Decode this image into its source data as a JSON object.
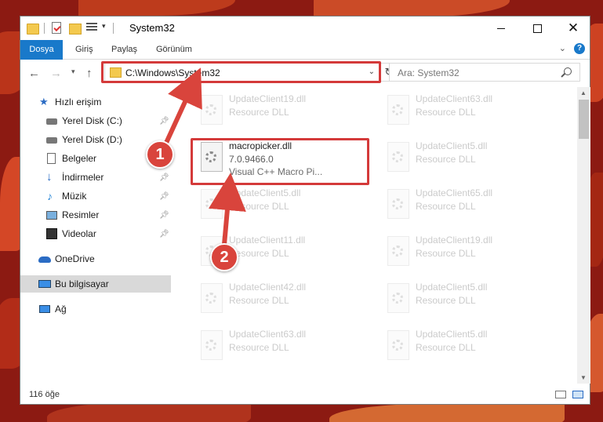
{
  "window": {
    "title": "System32",
    "controls": {
      "minimize": "",
      "maximize": "",
      "close": "✕"
    }
  },
  "ribbon": {
    "tabs": [
      "Dosya",
      "Giriş",
      "Paylaş",
      "Görünüm"
    ],
    "help": "?"
  },
  "address": {
    "path": "C:\\Windows\\System32",
    "search_placeholder": "Ara: System32"
  },
  "sidebar": {
    "quick_access": "Hızlı erişim",
    "items": [
      {
        "label": "Yerel Disk (C:)",
        "icon": "disk-icon",
        "pinned": true
      },
      {
        "label": "Yerel Disk (D:)",
        "icon": "disk-icon",
        "pinned": false
      },
      {
        "label": "Belgeler",
        "icon": "documents-icon",
        "pinned": true
      },
      {
        "label": "İndirmeler",
        "icon": "download-icon",
        "pinned": true
      },
      {
        "label": "Müzik",
        "icon": "music-icon",
        "pinned": true
      },
      {
        "label": "Resimler",
        "icon": "pictures-icon",
        "pinned": true
      },
      {
        "label": "Videolar",
        "icon": "videos-icon",
        "pinned": true
      }
    ],
    "onedrive": "OneDrive",
    "this_pc": "Bu bilgisayar",
    "network": "Ağ"
  },
  "files": {
    "focus": {
      "name": "macropicker.dll",
      "version": "7.0.9466.0",
      "description": "Visual C++ Macro Pi..."
    },
    "left_column": [
      {
        "name": "UpdateClient19.dll",
        "type": "Resource DLL"
      },
      {
        "name": "UpdateClient5.dll",
        "type": "Resource DLL"
      },
      {
        "name": "UpdateClient11.dll",
        "type": "Resource DLL"
      },
      {
        "name": "UpdateClient42.dll",
        "type": "Resource DLL"
      },
      {
        "name": "UpdateClient63.dll",
        "type": "Resource DLL"
      }
    ],
    "right_column": [
      {
        "name": "UpdateClient63.dll",
        "type": "Resource DLL"
      },
      {
        "name": "UpdateClient5.dll",
        "type": "Resource DLL"
      },
      {
        "name": "UpdateClient65.dll",
        "type": "Resource DLL"
      },
      {
        "name": "UpdateClient19.dll",
        "type": "Resource DLL"
      },
      {
        "name": "UpdateClient5.dll",
        "type": "Resource DLL"
      },
      {
        "name": "UpdateClient5.dll",
        "type": "Resource DLL"
      }
    ]
  },
  "status": {
    "count": "116 öğe"
  },
  "annotations": {
    "step1": "1",
    "step2": "2",
    "color": "#d9443c"
  }
}
